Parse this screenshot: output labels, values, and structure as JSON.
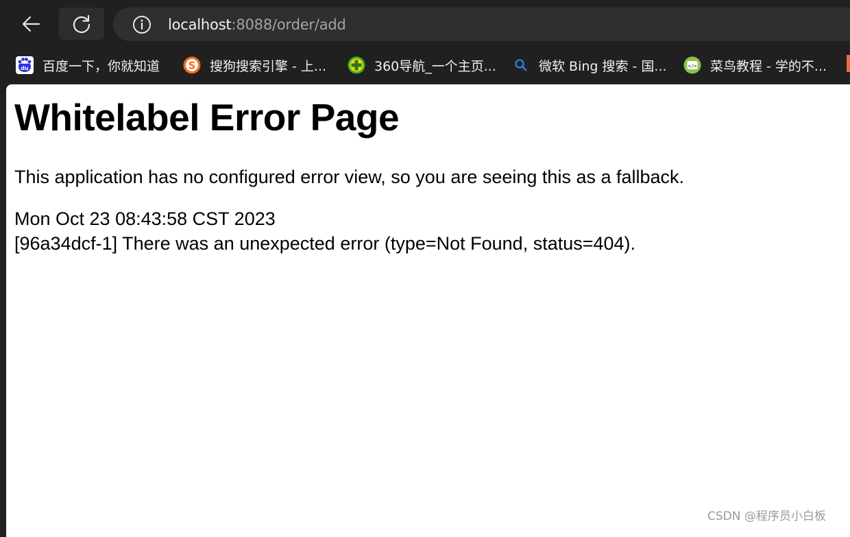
{
  "browser": {
    "address_bar": {
      "host": "localhost",
      "rest": ":8088/order/add"
    },
    "bookmarks": [
      {
        "icon": "baidu-icon",
        "label": "百度一下，你就知道",
        "color": "#2932e1"
      },
      {
        "icon": "sogou-icon",
        "label": "搜狗搜索引擎 - 上...",
        "color": "#f26a22"
      },
      {
        "icon": "360-icon",
        "label": "360导航_一个主页...",
        "color": "#3fb22e"
      },
      {
        "icon": "bing-search-icon",
        "label": "微软 Bing 搜索 - 国...",
        "color": "#2b79d6"
      },
      {
        "icon": "runoob-icon",
        "label": "菜鸟教程 - 学的不...",
        "color": "#8bc34a"
      }
    ]
  },
  "page": {
    "title": "Whitelabel Error Page",
    "description": "This application has no configured error view, so you are seeing this as a fallback.",
    "timestamp": "Mon Oct 23 08:43:58 CST 2023",
    "error": "[96a34dcf-1] There was an unexpected error (type=Not Found, status=404)."
  },
  "watermark": "CSDN @程序员小白板"
}
